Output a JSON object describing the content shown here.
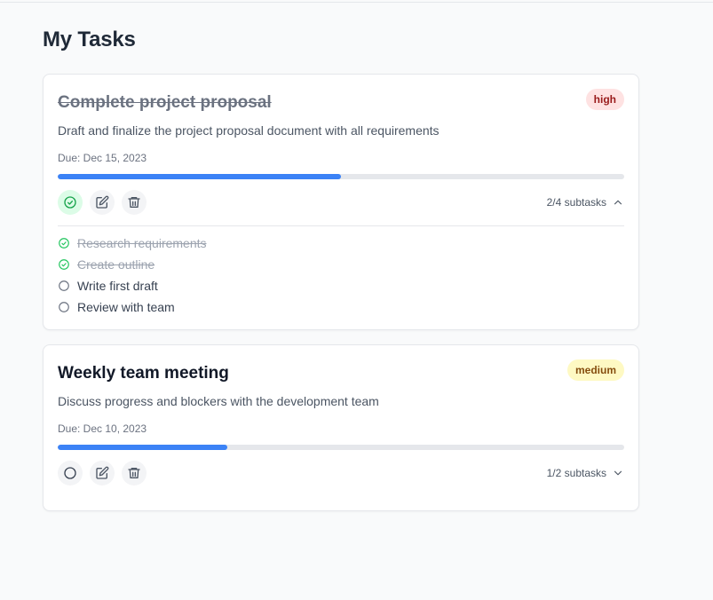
{
  "page": {
    "title": "My Tasks"
  },
  "colors": {
    "accent": "#3b82f6",
    "complete": "#22c55e",
    "high_bg": "#fee2e2",
    "high_text": "#991b1b",
    "medium_bg": "#fef9c3",
    "medium_text": "#854d0e"
  },
  "tasks": [
    {
      "title": "Complete project proposal",
      "completed": true,
      "priority": "high",
      "description": "Draft and finalize the project proposal document with all requirements",
      "due": "Due: Dec 15, 2023",
      "progress": 0.5,
      "subtask_summary": "2/4 subtasks",
      "expanded": true,
      "icons": {
        "status": "check-circle-icon",
        "edit": "edit-icon",
        "delete": "trash-icon",
        "toggle": "chevron-up-icon"
      },
      "subtasks": [
        {
          "label": "Research requirements",
          "done": true
        },
        {
          "label": "Create outline",
          "done": true
        },
        {
          "label": "Write first draft",
          "done": false
        },
        {
          "label": "Review with team",
          "done": false
        }
      ]
    },
    {
      "title": "Weekly team meeting",
      "completed": false,
      "priority": "medium",
      "description": "Discuss progress and blockers with the development team",
      "due": "Due: Dec 10, 2023",
      "progress": 0.3,
      "subtask_summary": "1/2 subtasks",
      "expanded": false,
      "icons": {
        "status": "circle-icon",
        "edit": "edit-icon",
        "delete": "trash-icon",
        "toggle": "chevron-down-icon"
      }
    }
  ]
}
